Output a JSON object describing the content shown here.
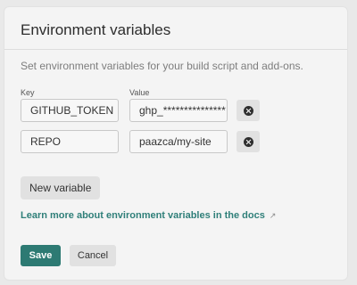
{
  "card": {
    "title": "Environment variables",
    "description": "Set environment variables for your build script and add-ons."
  },
  "columns": {
    "key_label": "Key",
    "value_label": "Value"
  },
  "variables": [
    {
      "key": "GITHUB_TOKEN",
      "value": "ghp_***************"
    },
    {
      "key": "REPO",
      "value": "paazca/my-site"
    }
  ],
  "actions": {
    "new_variable": "New variable",
    "learn_more": "Learn more about environment variables in the docs",
    "learn_more_icon": "↗",
    "save": "Save",
    "cancel": "Cancel"
  },
  "colors": {
    "accent": "#2d7a73",
    "link": "#2f7f79",
    "background": "#e9e9e9",
    "card": "#f4f4f4"
  }
}
